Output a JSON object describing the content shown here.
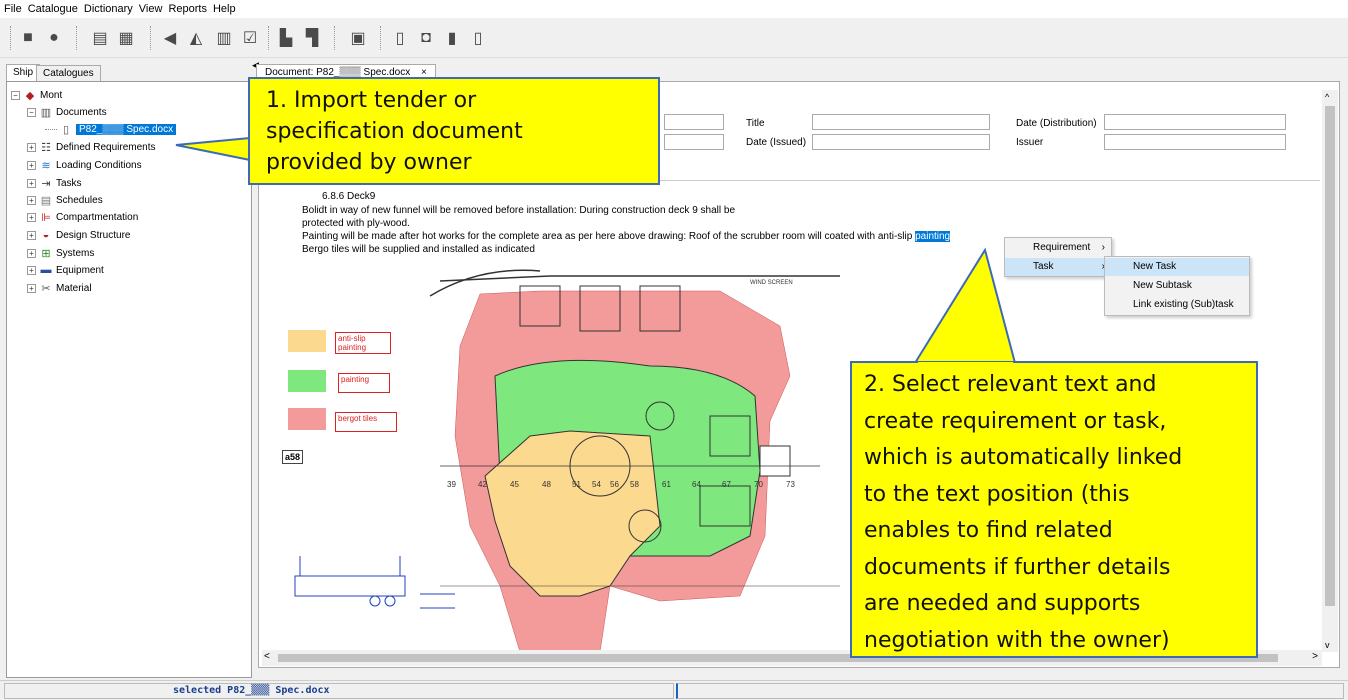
{
  "menu": [
    "File",
    "Catalogue",
    "Dictionary",
    "View",
    "Reports",
    "Help"
  ],
  "left_tabs": [
    "Ship",
    "Catalogues"
  ],
  "tree": {
    "root": "Mont",
    "documents": "Documents",
    "selected_doc": "P82_▒▒▒ Spec.docx",
    "items": [
      "Defined Requirements",
      "Loading Conditions",
      "Tasks",
      "Schedules",
      "Compartmentation",
      "Design Structure",
      "Systems",
      "Equipment",
      "Material"
    ]
  },
  "doc_tab": "Document: P82_▒▒▒ Spec.docx",
  "meta": {
    "title_label": "Title",
    "date_issued_label": "Date (Issued)",
    "date_distribution_label": "Date (Distribution)",
    "issuer_label": "Issuer"
  },
  "doc_text": {
    "heading": "6.8.6 Deck9",
    "line1": "Bolidt in way of new funnel will be removed before installation: During construction deck 9 shall be",
    "line2": "protected with ply-wood.",
    "line3_a": "Painting will be made after hot works for the complete area as per here above drawing:   Roof of the scrubber room will coated with anti-slip ",
    "line3_sel": "painting",
    "line4": "Bergo tiles will be supplied and installed as indicated"
  },
  "legend": {
    "anti_slip": "anti-slip painting",
    "painting": "painting",
    "bergot": "bergot tiles",
    "tag": "a58"
  },
  "drawing_labels": {
    "frames": [
      "39",
      "42",
      "45",
      "48",
      "51",
      "54",
      "56",
      "58",
      "61",
      "64",
      "67",
      "70",
      "73"
    ],
    "wind_screen": "WIND SCREEN"
  },
  "context_menu": {
    "requirement": "Requirement",
    "task": "Task",
    "sub": [
      "New Task",
      "New Subtask",
      "Link existing (Sub)task"
    ]
  },
  "callouts": {
    "c1": [
      "1. Import tender or",
      "specification document",
      "provided by owner"
    ],
    "c2": [
      "2. Select relevant text and",
      "create requirement or task,",
      "which is automatically linked",
      "to the text position (this",
      "enables to find related",
      "documents if further details",
      "are needed and supports",
      "negotiation with the owner)"
    ]
  },
  "status": {
    "text": "selected P82_▒▒▒ Spec.docx"
  },
  "colors": {
    "callout": "#ffff00",
    "callout_border": "#3c6ab4",
    "selection": "#0078d7",
    "anti_slip": "#fbd98e",
    "painting": "#7ee87e",
    "bergot": "#f39a9a"
  }
}
